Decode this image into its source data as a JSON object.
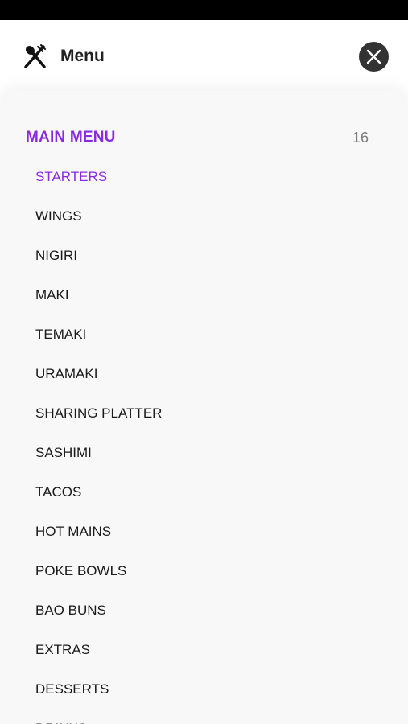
{
  "header": {
    "title": "Menu",
    "icon": "fork-spoon-icon",
    "close_icon": "close-icon"
  },
  "section": {
    "title": "MAIN MENU",
    "count": "16"
  },
  "menu_items": [
    {
      "label": "STARTERS",
      "active": true
    },
    {
      "label": "WINGS",
      "active": false
    },
    {
      "label": "NIGIRI",
      "active": false
    },
    {
      "label": "MAKI",
      "active": false
    },
    {
      "label": "TEMAKI",
      "active": false
    },
    {
      "label": "URAMAKI",
      "active": false
    },
    {
      "label": "SHARING PLATTER",
      "active": false
    },
    {
      "label": "SASHIMI",
      "active": false
    },
    {
      "label": "TACOS",
      "active": false
    },
    {
      "label": "HOT MAINS",
      "active": false
    },
    {
      "label": "POKE BOWLS",
      "active": false
    },
    {
      "label": "BAO BUNS",
      "active": false
    },
    {
      "label": "EXTRAS",
      "active": false
    },
    {
      "label": "DESSERTS",
      "active": false
    },
    {
      "label": "DRINKS",
      "active": false
    }
  ],
  "colors": {
    "accent": "#8a2be2",
    "text": "#1a1a1a",
    "count": "#7a7a7a",
    "close_button": "#333333"
  }
}
